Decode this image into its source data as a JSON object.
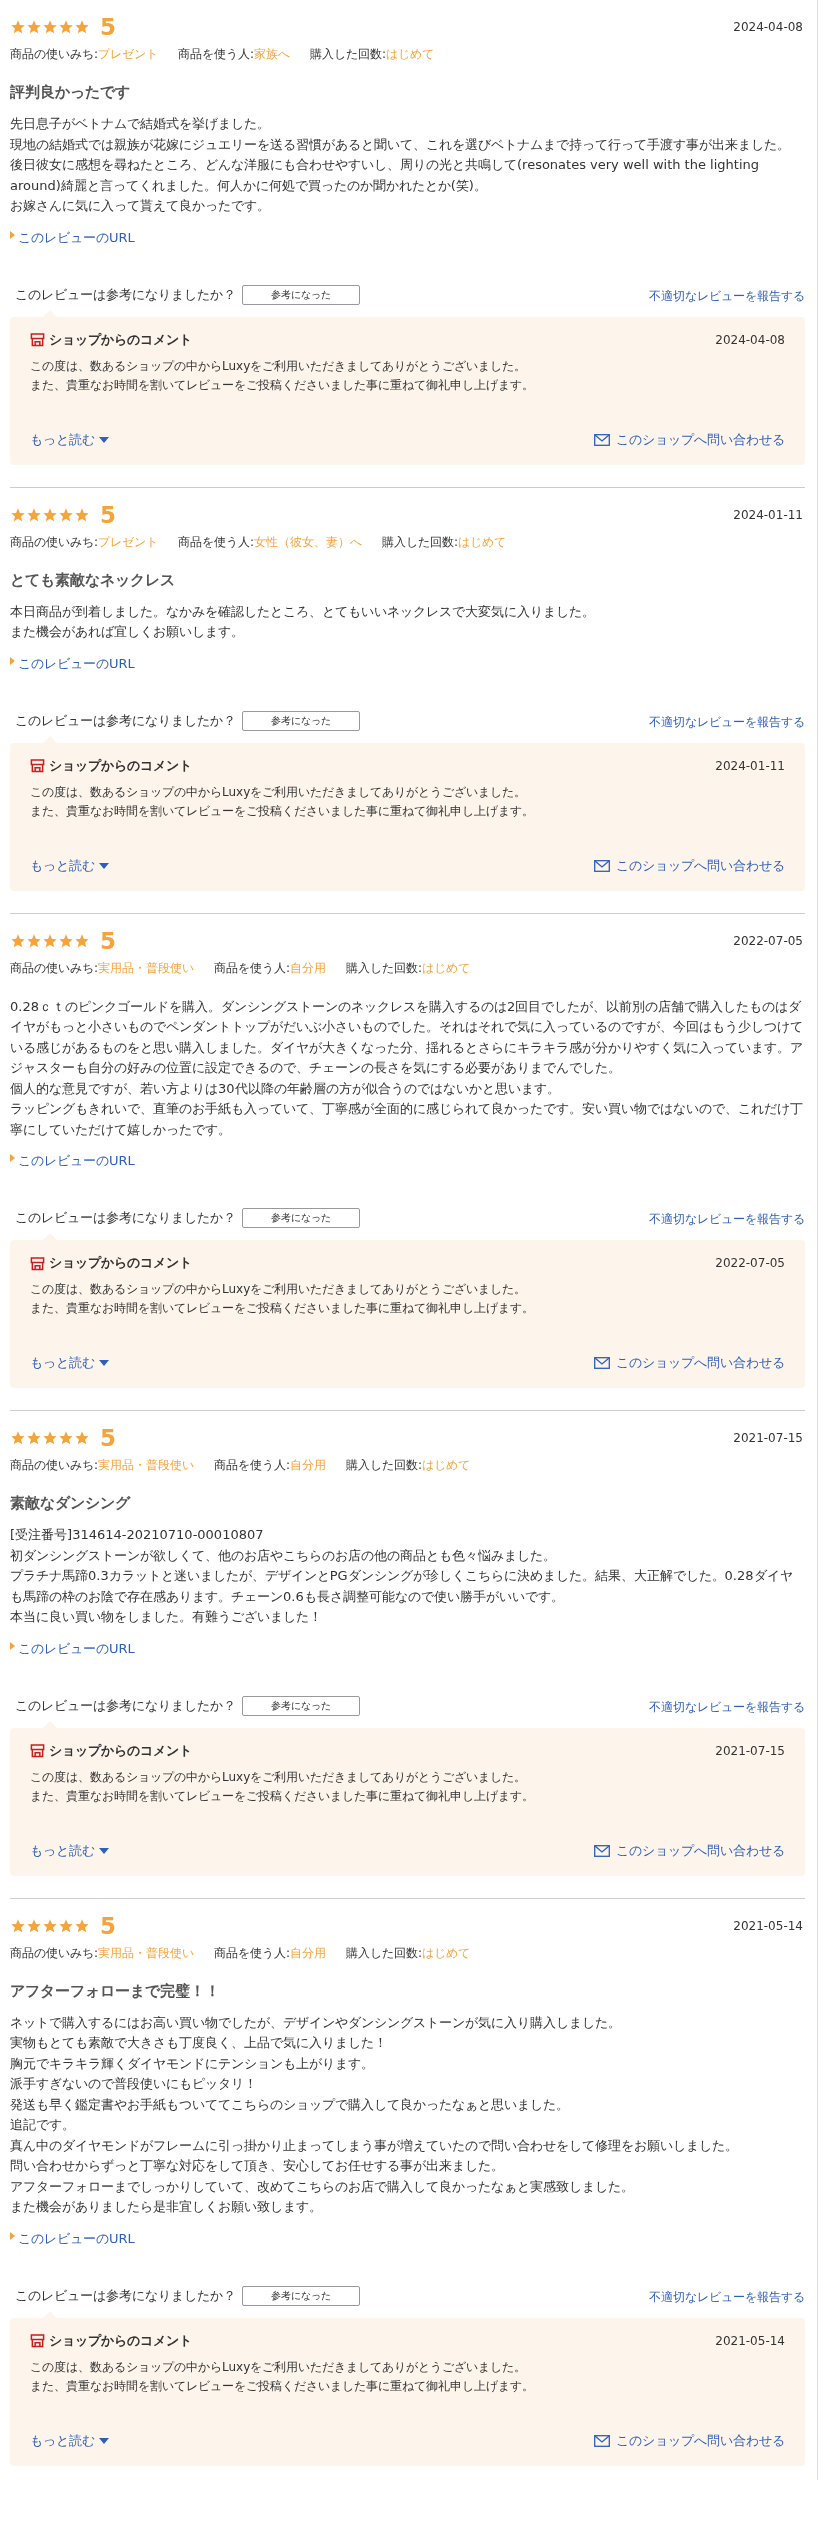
{
  "reviews": [
    {
      "stars": 5,
      "rating": "5",
      "date": "2024-04-08",
      "meta": [
        {
          "label": "商品の使いみち:",
          "value": "プレゼント"
        },
        {
          "label": "商品を使う人:",
          "value": "家族へ"
        },
        {
          "label": "購入した回数:",
          "value": "はじめて"
        }
      ],
      "title": "評判良かったです",
      "body": [
        "先日息子がベトナムで結婚式を挙げました。",
        "現地の結婚式では親族が花嫁にジュエリーを送る習慣があると聞いて、これを選びベトナムまで持って行って手渡す事が出来ました。",
        "後日彼女に感想を尋ねたところ、どんな洋服にも合わせやすいし、周りの光と共鳴して(resonates very well with the lighting around)綺麗と言ってくれました。何人かに何処で買ったのか聞かれたとか(笑)。",
        "お嫁さんに気に入って貰えて良かったです。"
      ],
      "url_link": "このレビューのURL",
      "helpful_question": "このレビューは参考になりましたか？",
      "helpful_button": "参考になった",
      "report_link": "不適切なレビューを報告する",
      "shop_comment": {
        "heading": "ショップからのコメント",
        "date": "2024-04-08",
        "body": [
          "この度は、数あるショップの中からLuxyをご利用いただきましてありがとうございました。",
          "また、貴重なお時間を割いてレビューをご投稿くださいました事に重ねて御礼申し上げます。"
        ],
        "more_link": "もっと読む",
        "contact_link": "このショップへ問い合わせる"
      }
    },
    {
      "stars": 5,
      "rating": "5",
      "date": "2024-01-11",
      "meta": [
        {
          "label": "商品の使いみち:",
          "value": "プレゼント"
        },
        {
          "label": "商品を使う人:",
          "value": "女性（彼女、妻）へ"
        },
        {
          "label": "購入した回数:",
          "value": "はじめて"
        }
      ],
      "title": "とても素敵なネックレス",
      "body": [
        "本日商品が到着しました。なかみを確認したところ、とてもいいネックレスで大変気に入りました。",
        "また機会があれば宜しくお願いします。"
      ],
      "url_link": "このレビューのURL",
      "helpful_question": "このレビューは参考になりましたか？",
      "helpful_button": "参考になった",
      "report_link": "不適切なレビューを報告する",
      "shop_comment": {
        "heading": "ショップからのコメント",
        "date": "2024-01-11",
        "body": [
          "この度は、数あるショップの中からLuxyをご利用いただきましてありがとうございました。",
          "また、貴重なお時間を割いてレビューをご投稿くださいました事に重ねて御礼申し上げます。"
        ],
        "more_link": "もっと読む",
        "contact_link": "このショップへ問い合わせる"
      }
    },
    {
      "stars": 5,
      "rating": "5",
      "date": "2022-07-05",
      "meta": [
        {
          "label": "商品の使いみち:",
          "value": "実用品・普段使い"
        },
        {
          "label": "商品を使う人:",
          "value": "自分用"
        },
        {
          "label": "購入した回数:",
          "value": "はじめて"
        }
      ],
      "body": [
        "0.28ｃｔのピンクゴールドを購入。ダンシングストーンのネックレスを購入するのは2回目でしたが、以前別の店舗で購入したものはダイヤがもっと小さいものでペンダントトップがだいぶ小さいものでした。それはそれで気に入っているのですが、今回はもう少しつけている感じがあるものをと思い購入しました。ダイヤが大きくなった分、揺れるとさらにキラキラ感が分かりやすく気に入っています。アジャスターも自分の好みの位置に設定できるので、チェーンの長さを気にする必要がありまでんでした。",
        "個人的な意見ですが、若い方よりは30代以降の年齢層の方が似合うのではないかと思います。",
        "ラッピングもきれいで、直筆のお手紙も入っていて、丁寧感が全面的に感じられて良かったです。安い買い物ではないので、これだけ丁寧にしていただけて嬉しかったです。"
      ],
      "url_link": "このレビューのURL",
      "helpful_question": "このレビューは参考になりましたか？",
      "helpful_button": "参考になった",
      "report_link": "不適切なレビューを報告する",
      "shop_comment": {
        "heading": "ショップからのコメント",
        "date": "2022-07-05",
        "body": [
          "この度は、数あるショップの中からLuxyをご利用いただきましてありがとうございました。",
          "また、貴重なお時間を割いてレビューをご投稿くださいました事に重ねて御礼申し上げます。"
        ],
        "more_link": "もっと読む",
        "contact_link": "このショップへ問い合わせる"
      }
    },
    {
      "stars": 5,
      "rating": "5",
      "date": "2021-07-15",
      "meta": [
        {
          "label": "商品の使いみち:",
          "value": "実用品・普段使い"
        },
        {
          "label": "商品を使う人:",
          "value": "自分用"
        },
        {
          "label": "購入した回数:",
          "value": "はじめて"
        }
      ],
      "title": "素敵なダンシング",
      "body": [
        "[受注番号]314614-20210710-00010807",
        "初ダンシングストーンが欲しくて、他のお店やこちらのお店の他の商品とも色々悩みました。",
        "プラチナ馬蹄0.3カラットと迷いましたが、デザインとPGダンシングが珍しくこちらに決めました。結果、大正解でした。0.28ダイヤも馬蹄の枠のお陰で存在感あります。チェーン0.6も長さ調整可能なので使い勝手がいいです。",
        "本当に良い買い物をしました。有難うございました！"
      ],
      "url_link": "このレビューのURL",
      "helpful_question": "このレビューは参考になりましたか？",
      "helpful_button": "参考になった",
      "report_link": "不適切なレビューを報告する",
      "shop_comment": {
        "heading": "ショップからのコメント",
        "date": "2021-07-15",
        "body": [
          "この度は、数あるショップの中からLuxyをご利用いただきましてありがとうございました。",
          "また、貴重なお時間を割いてレビューをご投稿くださいました事に重ねて御礼申し上げます。"
        ],
        "more_link": "もっと読む",
        "contact_link": "このショップへ問い合わせる"
      }
    },
    {
      "stars": 5,
      "rating": "5",
      "date": "2021-05-14",
      "meta": [
        {
          "label": "商品の使いみち:",
          "value": "実用品・普段使い"
        },
        {
          "label": "商品を使う人:",
          "value": "自分用"
        },
        {
          "label": "購入した回数:",
          "value": "はじめて"
        }
      ],
      "title": "アフターフォローまで完璧！！",
      "body": [
        "ネットで購入するにはお高い買い物でしたが、デザインやダンシングストーンが気に入り購入しました。",
        "実物もとても素敵で大きさも丁度良く、上品で気に入りました！",
        "胸元でキラキラ輝くダイヤモンドにテンションも上がります。",
        "派手すぎないので普段使いにもピッタリ！",
        "発送も早く鑑定書やお手紙もついててこちらのショップで購入して良かったなぁと思いました。",
        "追記です。",
        "真ん中のダイヤモンドがフレームに引っ掛かり止まってしまう事が増えていたので問い合わせをして修理をお願いしました。",
        "問い合わせからずっと丁寧な対応をして頂き、安心してお任せする事が出来ました。",
        "アフターフォローまでしっかりしていて、改めてこちらのお店で購入して良かったなぁと実感致しました。",
        "また機会がありましたら是非宜しくお願い致します。"
      ],
      "url_link": "このレビューのURL",
      "helpful_question": "このレビューは参考になりましたか？",
      "helpful_button": "参考になった",
      "report_link": "不適切なレビューを報告する",
      "shop_comment": {
        "heading": "ショップからのコメント",
        "date": "2021-05-14",
        "body": [
          "この度は、数あるショップの中からLuxyをご利用いただきましてありがとうございました。",
          "また、貴重なお時間を割いてレビューをご投稿くださいました事に重ねて御礼申し上げます。"
        ],
        "more_link": "もっと読む",
        "contact_link": "このショップへ問い合わせる"
      }
    }
  ]
}
